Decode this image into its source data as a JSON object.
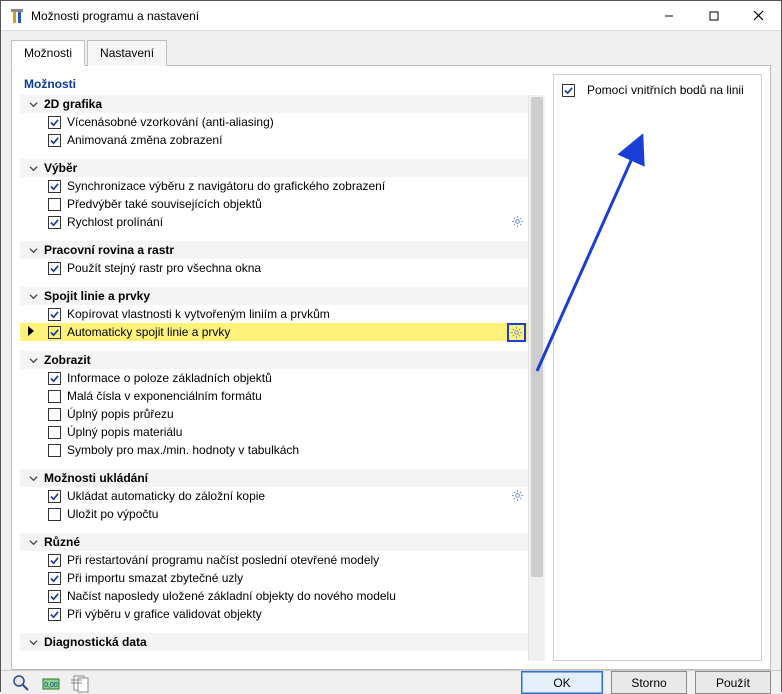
{
  "window": {
    "title": "Možnosti programu a nastavení"
  },
  "tabs": {
    "t0": "Možnosti",
    "t1": "Nastavení"
  },
  "left_header": "Možnosti",
  "groups": {
    "g0": {
      "title": "2D grafika",
      "items": {
        "i0": "Vícenásobné vzorkování (anti-aliasing)",
        "i1": "Animovaná změna zobrazení"
      }
    },
    "g1": {
      "title": "Výběr",
      "items": {
        "i0": "Synchronizace výběru z navigátoru do grafického zobrazení",
        "i1": "Předvýběr také souvisejících objektů",
        "i2": "Rychlost prolínání"
      }
    },
    "g2": {
      "title": "Pracovní rovina a rastr",
      "items": {
        "i0": "Použít stejný rastr pro všechna okna"
      }
    },
    "g3": {
      "title": "Spojit linie a prvky",
      "items": {
        "i0": "Kopírovat vlastnosti k vytvořeným liniím a prvkům",
        "i1": "Automaticky spojit linie a prvky"
      }
    },
    "g4": {
      "title": "Zobrazit",
      "items": {
        "i0": "Informace o poloze základních objektů",
        "i1": "Malá čísla v exponenciálním formátu",
        "i2": "Úplný popis průřezu",
        "i3": "Úplný popis materiálu",
        "i4": "Symboly pro max./min. hodnoty v tabulkách"
      }
    },
    "g5": {
      "title": "Možnosti ukládání",
      "items": {
        "i0": "Ukládat automaticky do záložní kopie",
        "i1": "Uložit po výpočtu"
      }
    },
    "g6": {
      "title": "Různé",
      "items": {
        "i0": "Při restartování programu načíst poslední otevřené modely",
        "i1": "Při importu smazat zbytečné uzly",
        "i2": "Načíst naposledy uložené základní objekty do nového modelu",
        "i3": "Při výběru v grafice validovat objekty"
      }
    },
    "g7": {
      "title": "Diagnostická data"
    }
  },
  "right": {
    "opt0": "Pomocí vnitřních bodů na linii"
  },
  "buttons": {
    "ok": "OK",
    "cancel": "Storno",
    "apply": "Použít"
  }
}
